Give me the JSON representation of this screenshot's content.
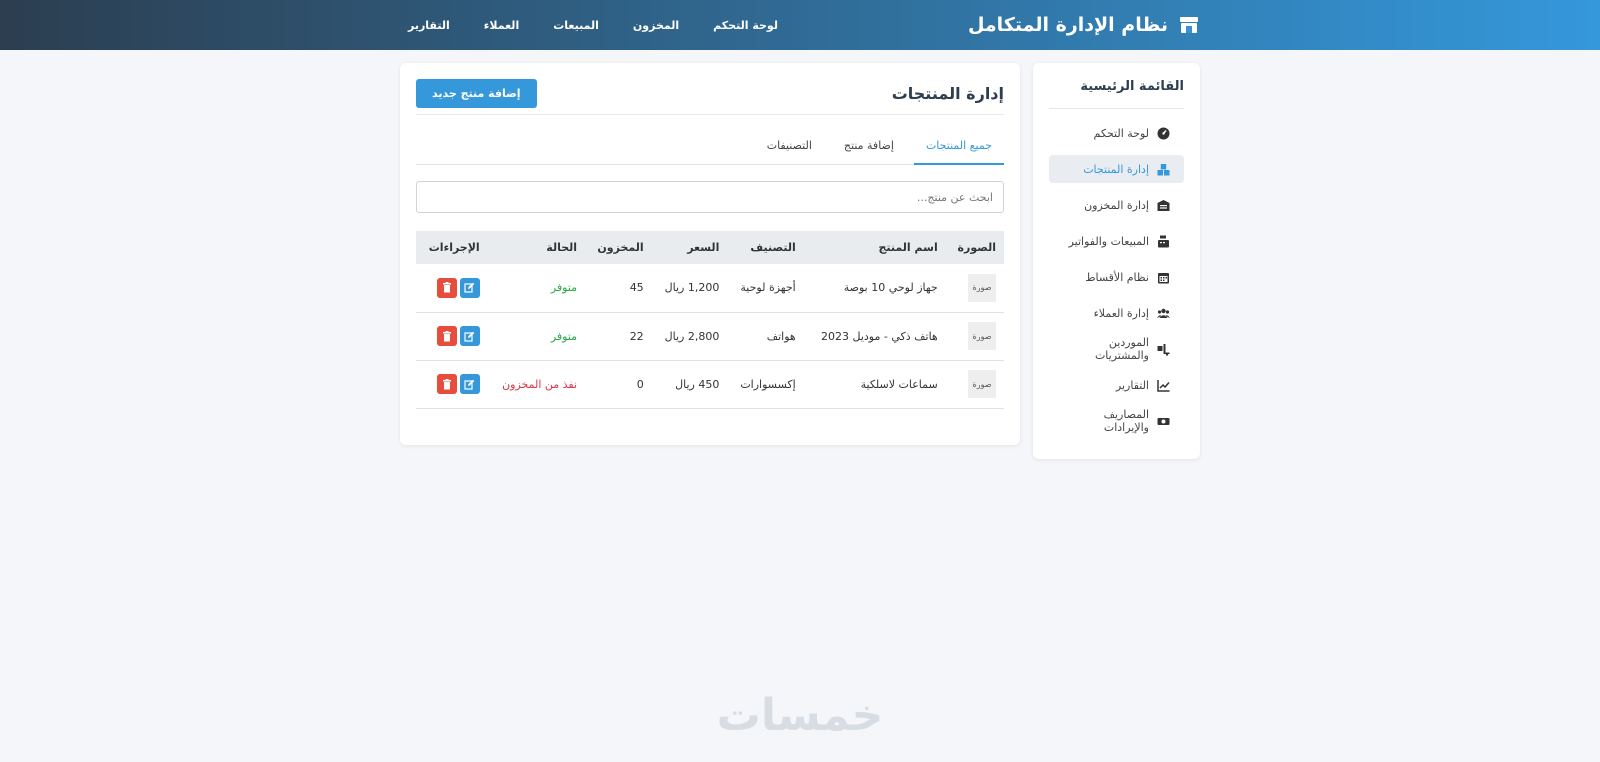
{
  "header": {
    "brand": "نظام الإدارة المتكامل",
    "nav": [
      "لوحة التحكم",
      "المخزون",
      "المبيعات",
      "العملاء",
      "التقارير"
    ]
  },
  "sidebar": {
    "title": "القائمة الرئيسية",
    "items": [
      {
        "label": "لوحة التحكم",
        "icon": "dashboard-icon"
      },
      {
        "label": "إدارة المنتجات",
        "icon": "boxes-icon",
        "active": true
      },
      {
        "label": "إدارة المخزون",
        "icon": "warehouse-icon"
      },
      {
        "label": "المبيعات والفواتير",
        "icon": "cash-register-icon"
      },
      {
        "label": "نظام الأقساط",
        "icon": "calendar-icon"
      },
      {
        "label": "إدارة العملاء",
        "icon": "users-icon"
      },
      {
        "label": "الموردين والمشتريات",
        "icon": "truck-loading-icon"
      },
      {
        "label": "التقارير",
        "icon": "chart-line-icon"
      },
      {
        "label": "المصاريف والإيرادات",
        "icon": "money-bill-icon"
      }
    ]
  },
  "main": {
    "title": "إدارة المنتجات",
    "add_button": "إضافة منتج جديد",
    "tabs": [
      "جميع المنتجات",
      "إضافة منتج",
      "التصنيفات"
    ],
    "search_placeholder": "ابحث عن منتج...",
    "columns": [
      "الصورة",
      "اسم المنتج",
      "التصنيف",
      "السعر",
      "المخزون",
      "الحالة",
      "الإجراءات"
    ],
    "rows": [
      {
        "image": "صورة",
        "name": "جهاز لوحي 10 بوصة",
        "category": "أجهزة لوحية",
        "price": "1,200 ريال",
        "stock": "45",
        "status": "متوفر",
        "status_type": "ok"
      },
      {
        "image": "صورة",
        "name": "هاتف ذكي - موديل 2023",
        "category": "هواتف",
        "price": "2,800 ريال",
        "stock": "22",
        "status": "متوفر",
        "status_type": "ok"
      },
      {
        "image": "صورة",
        "name": "سماعات لاسلكية",
        "category": "إكسسوارات",
        "price": "450 ريال",
        "stock": "0",
        "status": "نفذ من المخزون",
        "status_type": "out"
      }
    ]
  },
  "watermark": "خمسات",
  "colors": {
    "accent": "#3498db",
    "header_dark": "#2c3e50",
    "success": "#28a745",
    "danger": "#e74c3c"
  }
}
